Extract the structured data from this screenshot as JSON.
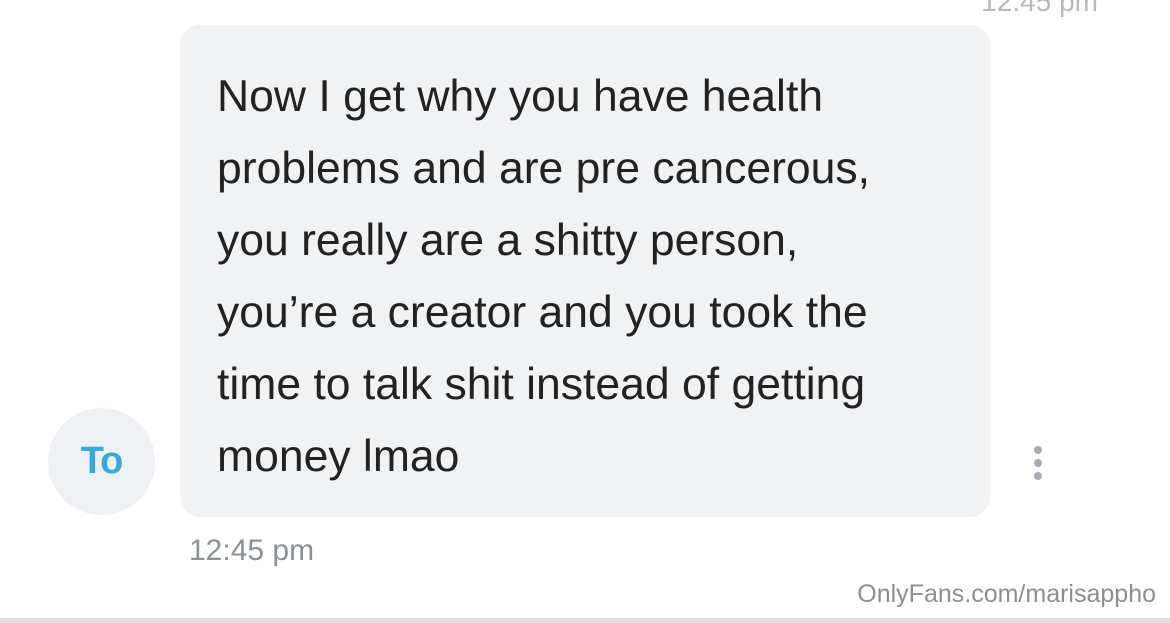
{
  "header": {
    "clipped_time": "12:45 pm"
  },
  "message": {
    "avatar_initials": "To",
    "text": "Now I get why you have health\nproblems and are pre cancerous,\nyou really are a shitty person,\nyou’re a creator and you took the\ntime to talk shit instead of getting\nmoney lmao",
    "timestamp": "12:45 pm",
    "more_icon": "more-vertical-icon"
  },
  "watermark": {
    "text": "OnlyFans.com/marisappho"
  },
  "colors": {
    "bubble_bg": "#f1f2f4",
    "avatar_bg": "#eef0f3",
    "avatar_text": "#38a8de",
    "message_text": "#222222",
    "timestamp": "#8b9096"
  }
}
